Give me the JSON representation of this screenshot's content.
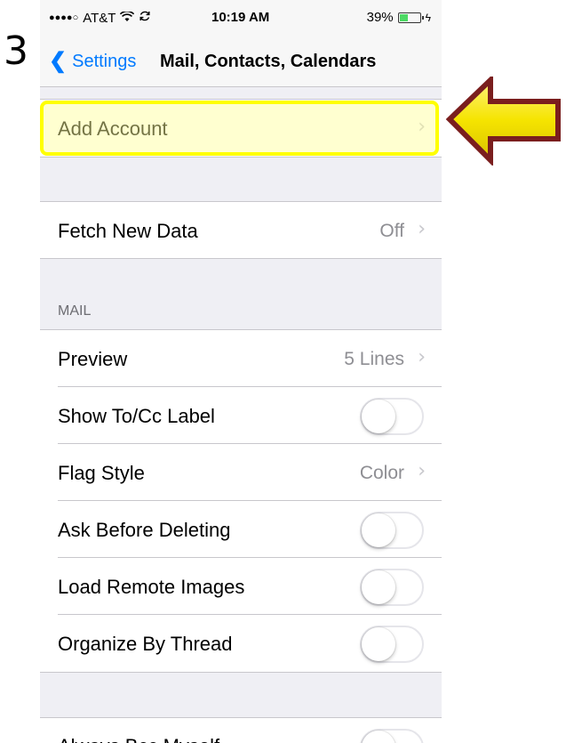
{
  "step_number": "3",
  "status_bar": {
    "signal": "●●●●○",
    "carrier": "AT&T",
    "wifi_icon": "wifi-icon",
    "sync_icon": "sync-icon",
    "time": "10:19 AM",
    "battery_percent": "39%",
    "battery_level": 0.39,
    "charging_icon": "ϟ"
  },
  "nav": {
    "back_chevron": "❮",
    "back_label": "Settings",
    "title": "Mail, Contacts, Calendars"
  },
  "chevron": "›",
  "accounts": {
    "add_account_label": "Add Account"
  },
  "fetch": {
    "label": "Fetch New Data",
    "value": "Off"
  },
  "mail_section": {
    "header": "MAIL",
    "preview": {
      "label": "Preview",
      "value": "5 Lines"
    },
    "show_to_cc": {
      "label": "Show To/Cc Label",
      "on": false
    },
    "flag_style": {
      "label": "Flag Style",
      "value": "Color"
    },
    "ask_before_deleting": {
      "label": "Ask Before Deleting",
      "on": false
    },
    "load_remote_images": {
      "label": "Load Remote Images",
      "on": false
    },
    "organize_by_thread": {
      "label": "Organize By Thread",
      "on": false
    }
  },
  "partial_row_label": "Always Bcc Myself",
  "colors": {
    "ios_blue": "#007aff",
    "highlight_yellow": "#ffff00",
    "arrow_yellow": "#f5e400",
    "arrow_outline": "#7a1e1e"
  }
}
